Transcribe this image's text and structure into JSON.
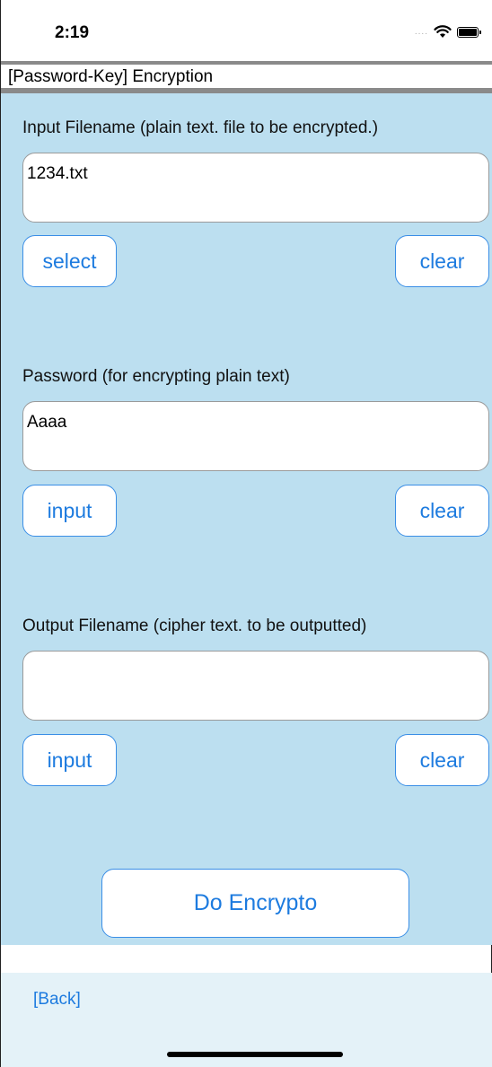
{
  "status_bar": {
    "time": "2:19",
    "signal_glyph": "....",
    "icons": [
      "signal-dots-icon",
      "wifi-icon",
      "battery-icon"
    ]
  },
  "title": "[Password-Key] Encryption",
  "input_section": {
    "label": "Input Filename (plain text. file to be encrypted.)",
    "value": "1234.txt",
    "select_label": "select",
    "clear_label": "clear"
  },
  "password_section": {
    "label": "Password (for encrypting plain text)",
    "value": "Aaaa",
    "input_label": "input",
    "clear_label": "clear"
  },
  "output_section": {
    "label": "Output Filename (cipher text. to be outputted)",
    "value": "",
    "input_label": "input",
    "clear_label": "clear"
  },
  "do_button_label": "Do Encrypto",
  "back_label": "[Back]",
  "colors": {
    "content_bg": "#bcdff0",
    "bottom_bg": "#e4f2f8",
    "accent": "#1d7bdf",
    "title_border": "#8a8a8a"
  }
}
